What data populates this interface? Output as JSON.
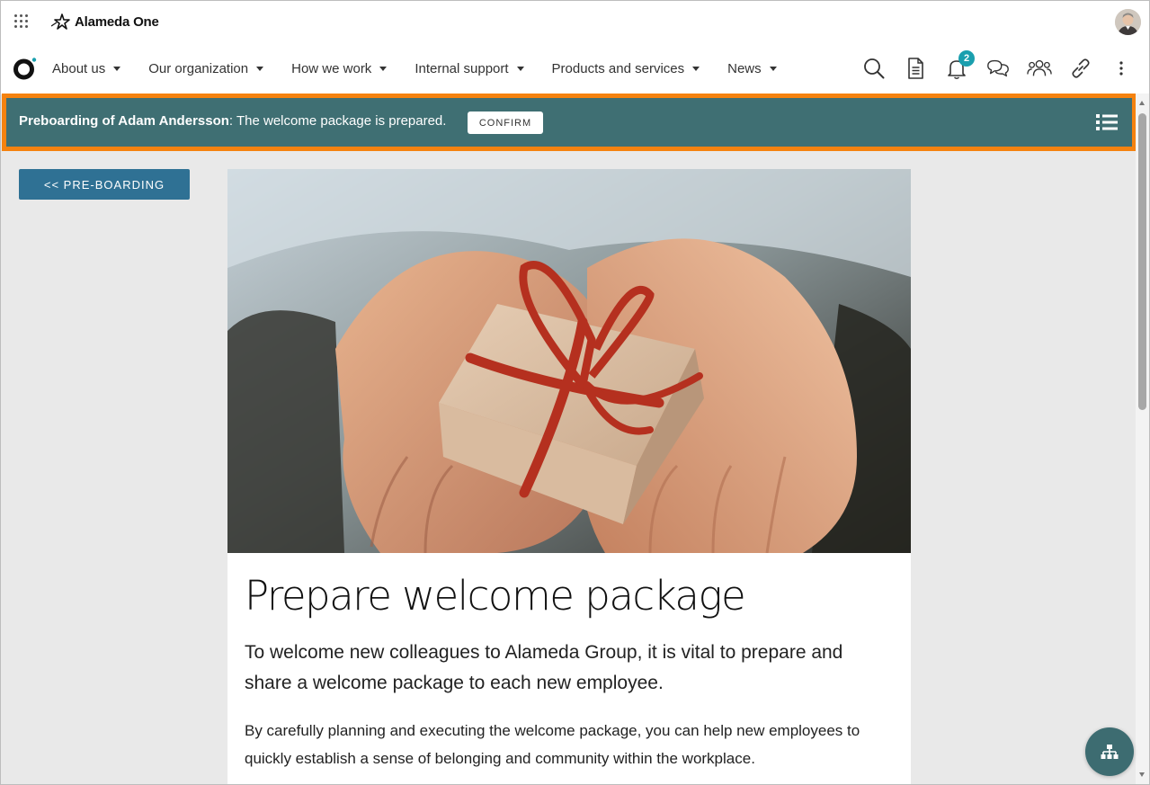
{
  "app": {
    "name": "Alameda One",
    "notification_count": "2"
  },
  "nav": {
    "items": [
      {
        "label": "About us"
      },
      {
        "label": "Our organization"
      },
      {
        "label": "How we work"
      },
      {
        "label": "Internal support"
      },
      {
        "label": "Products and services"
      },
      {
        "label": "News"
      }
    ],
    "icons": [
      "search-icon",
      "document-icon",
      "bell-icon",
      "chat-icon",
      "people-icon",
      "link-icon",
      "more-icon"
    ]
  },
  "banner": {
    "title": "Preboarding of Adam Andersson",
    "message": ": The welcome package is prepared.",
    "confirm_label": "CONFIRM",
    "accent_color": "#f5820f",
    "background_color": "#3f6f73"
  },
  "back_button": {
    "label": "<< PRE-BOARDING"
  },
  "article": {
    "title": "Prepare welcome package",
    "lead": "To welcome new colleagues to Alameda Group, it is vital to prepare and share a welcome package to each new employee.",
    "body": "By carefully planning and executing the welcome package, you can help new employees to quickly establish a sense of belonging and community within the workplace."
  },
  "colors": {
    "primary_button": "#2f7194",
    "badge": "#1a9fae"
  }
}
